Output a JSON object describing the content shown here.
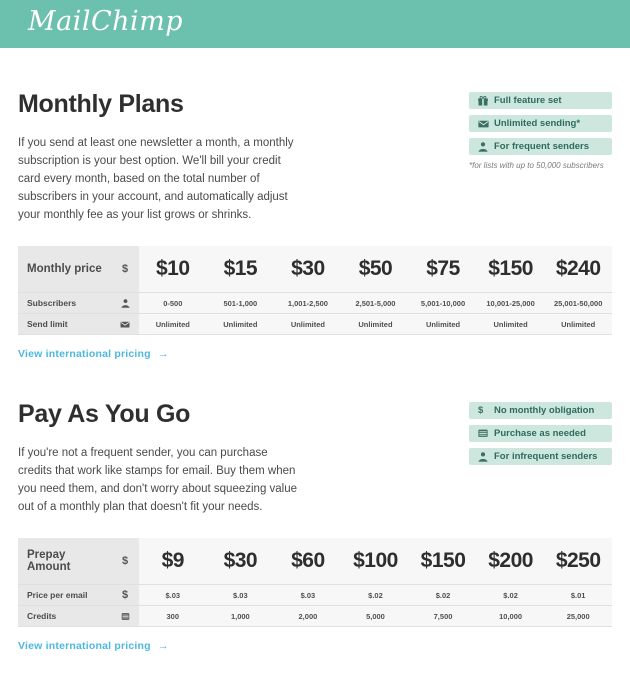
{
  "header": {
    "logo_text": "MailChimp",
    "brand_color": "#6cc0ae"
  },
  "colors": {
    "badge_bg": "#cde7df",
    "badge_text": "#2d6b5c",
    "table_label_bg": "#e8e8e8",
    "table_cell_bg": "#f7f7f7",
    "link": "#4cb8e0"
  },
  "monthly": {
    "title": "Monthly Plans",
    "description": "If you send at least one newsletter a month, a monthly subscription is your best option. We'll bill your credit card every month, based on the total number of subscribers in your account, and automatically adjust your monthly fee as your list grows or shrinks.",
    "badges": [
      {
        "icon": "gift-icon",
        "label": "Full feature set"
      },
      {
        "icon": "envelope-icon",
        "label": "Unlimited sending*"
      },
      {
        "icon": "person-icon",
        "label": "For frequent senders"
      }
    ],
    "footnote": "*for lists with up to 50,000 subscribers",
    "table": {
      "rows": [
        {
          "label": "Monthly price",
          "icon": "dollar-icon"
        },
        {
          "label": "Subscribers",
          "icon": "person-icon"
        },
        {
          "label": "Send limit",
          "icon": "envelope-icon"
        }
      ],
      "prices": [
        "$10",
        "$15",
        "$30",
        "$50",
        "$75",
        "$150",
        "$240"
      ],
      "subscribers": [
        "0-500",
        "501-1,000",
        "1,001-2,500",
        "2,501-5,000",
        "5,001-10,000",
        "10,001-25,000",
        "25,001-50,000"
      ],
      "send_limits": [
        "Unlimited",
        "Unlimited",
        "Unlimited",
        "Unlimited",
        "Unlimited",
        "Unlimited",
        "Unlimited"
      ]
    },
    "link": {
      "label": "View international pricing",
      "arrow": "→"
    }
  },
  "payg": {
    "title": "Pay As You Go",
    "description": "If you're not a frequent sender, you can purchase credits that work like stamps for email. Buy them when you need them, and don't worry about squeezing value out of a monthly plan that doesn't fit your needs.",
    "badges": [
      {
        "icon": "dollar-icon",
        "label": "No monthly obligation"
      },
      {
        "icon": "card-icon",
        "label": "Purchase as needed"
      },
      {
        "icon": "person-icon",
        "label": "For infrequent senders"
      }
    ],
    "table": {
      "rows": [
        {
          "label": "Prepay Amount",
          "icon": "dollar-icon"
        },
        {
          "label": "Price per email",
          "icon": "dollar-icon"
        },
        {
          "label": "Credits",
          "icon": "credits-icon"
        }
      ],
      "prices": [
        "$9",
        "$30",
        "$60",
        "$100",
        "$150",
        "$200",
        "$250"
      ],
      "price_per_email": [
        "$.03",
        "$.03",
        "$.03",
        "$.02",
        "$.02",
        "$.02",
        "$.01"
      ],
      "credits": [
        "300",
        "1,000",
        "2,000",
        "5,000",
        "7,500",
        "10,000",
        "25,000"
      ]
    },
    "link": {
      "label": "View international pricing",
      "arrow": "→"
    }
  }
}
